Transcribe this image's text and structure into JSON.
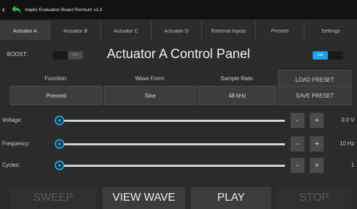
{
  "titlebar": {
    "back_icon": "back-chevron-icon",
    "logo_icon": "green-back-arrow-icon",
    "title": "Haptic Evaluation Board Premium v2.3"
  },
  "tabs": [
    {
      "label": "Actuator A",
      "active": true
    },
    {
      "label": "Actuator B",
      "active": false
    },
    {
      "label": "Actuator C",
      "active": false
    },
    {
      "label": "Actuator D",
      "active": false
    },
    {
      "label": "External Inputs",
      "active": false
    },
    {
      "label": "Presets",
      "active": false
    },
    {
      "label": "Settings",
      "active": false
    }
  ],
  "boost": {
    "label": "BOOST:",
    "state": "OFF"
  },
  "panel_title": "Actuator A Control Panel",
  "enable_toggle": {
    "state": "ON"
  },
  "params": {
    "function": {
      "label": "Function:",
      "value": "Pressed"
    },
    "wave_form": {
      "label": "Wave Form:",
      "value": "Sine"
    },
    "sample_rate": {
      "label": "Sample Rate:",
      "value": "48 kHz"
    }
  },
  "presets": {
    "load": "LOAD PRESET",
    "save": "SAVE PRESET"
  },
  "sliders": [
    {
      "label": "Voltage:",
      "value": "0.0 V",
      "level": 0
    },
    {
      "label": "Frequency:",
      "value": "10 Hz",
      "level": 0
    },
    {
      "label": "Cycles:",
      "value": "1",
      "level": 0
    }
  ],
  "stepper": {
    "minus": "-",
    "plus": "+"
  },
  "bottom": {
    "sweep": "SWEEP",
    "view_wave": "VIEW WAVE",
    "play": "PLAY",
    "stop": "STOP"
  },
  "colors": {
    "accent": "#1aa3e8",
    "background": "#2b2b2b",
    "titlebar": "#111111",
    "logo_green": "#3db04a"
  }
}
